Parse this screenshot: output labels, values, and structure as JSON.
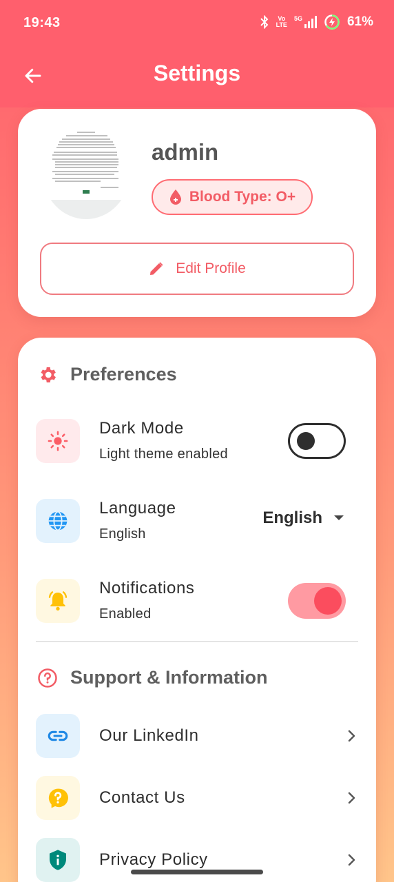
{
  "status_bar": {
    "time": "19:43",
    "volte_top": "Vo",
    "volte_bottom": "LTE",
    "network": "5G",
    "battery": "61%"
  },
  "app_bar": {
    "title": "Settings",
    "back_icon": "arrow-left-icon"
  },
  "profile": {
    "username": "admin",
    "blood_type_label": "Blood Type: O+",
    "edit_profile_label": "Edit Profile"
  },
  "preferences": {
    "title": "Preferences",
    "items": [
      {
        "title": "Dark Mode",
        "subtitle": "Light theme enabled",
        "icon": "sun-icon",
        "toggle_on": false
      },
      {
        "title": "Language",
        "subtitle": "English",
        "icon": "globe-icon",
        "selected": "English"
      },
      {
        "title": "Notifications",
        "subtitle": "Enabled",
        "icon": "bell-icon",
        "toggle_on": true
      }
    ]
  },
  "support": {
    "title": "Support & Information",
    "items": [
      {
        "title": "Our LinkedIn",
        "icon": "link-icon"
      },
      {
        "title": "Contact Us",
        "icon": "help-icon"
      },
      {
        "title": "Privacy Policy",
        "icon": "shield-icon"
      }
    ]
  },
  "colors": {
    "accent": "#ff5f6d",
    "toggle_on": "#fb4d5e",
    "text_dark": "#2e2e2e"
  }
}
